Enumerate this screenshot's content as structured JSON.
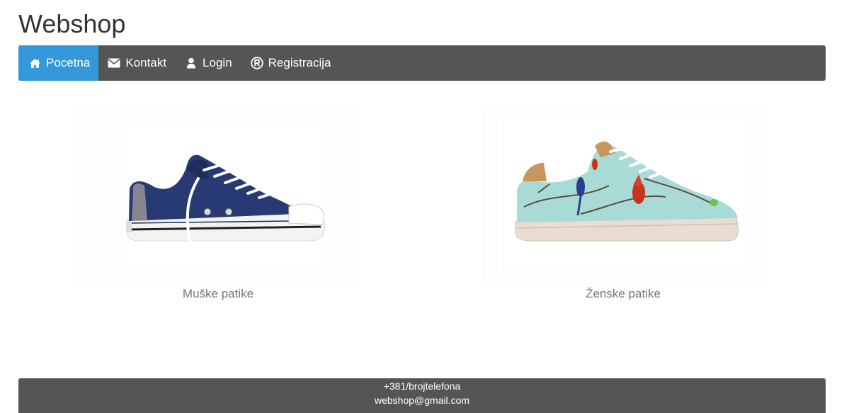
{
  "site": {
    "title": "Webshop"
  },
  "nav": {
    "items": [
      {
        "label": "Pocetna",
        "icon": "home-icon",
        "active": true
      },
      {
        "label": "Kontakt",
        "icon": "envelope-icon",
        "active": false
      },
      {
        "label": "Login",
        "icon": "user-icon",
        "active": false
      },
      {
        "label": "Registracija",
        "icon": "registered-icon",
        "active": false
      }
    ]
  },
  "categories": [
    {
      "label": "Muške patike",
      "image": "navy-canvas-sneaker"
    },
    {
      "label": "Ženske patike",
      "image": "bird-print-sneaker"
    }
  ],
  "footer": {
    "phone": "+381/brojtelefona",
    "email": "webshop@gmail.com"
  },
  "colors": {
    "navbar": "#555555",
    "active": "#3498db",
    "footer": "#555555"
  }
}
